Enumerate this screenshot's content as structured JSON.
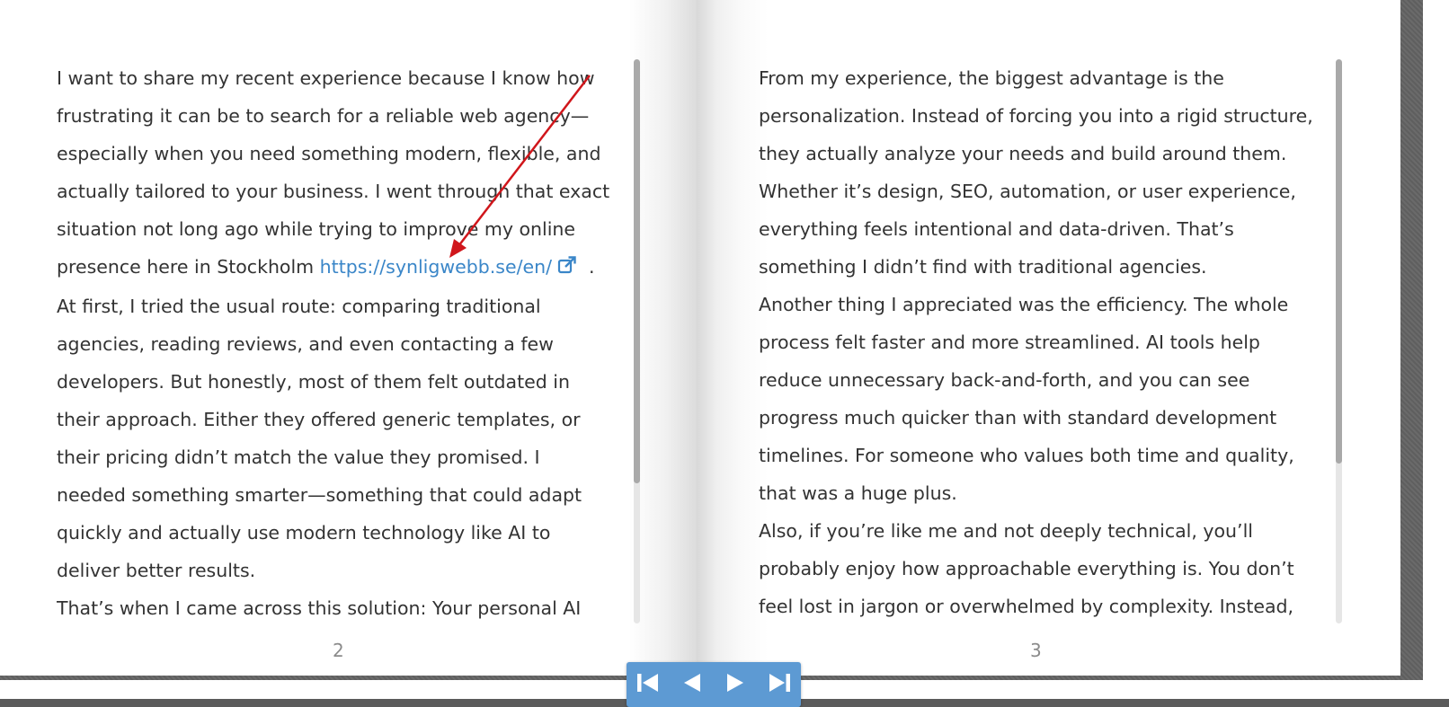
{
  "left_page": {
    "paragraphs": [
      {
        "text": "I want to share my recent experience because I know how frustrating it can be to search for a reliable web agency—especially when you need something modern, flexible, and actually tailored to your business. I went through that exact situation not long ago while trying to improve my online presence here in Stockholm",
        "link": "https://synligwebb.se/en/",
        "after": "."
      },
      {
        "text": "At first, I tried the usual route: comparing traditional agencies, reading reviews, and even contacting a few developers. But honestly, most of them felt outdated in their approach. Either they offered generic templates, or their pricing didn’t match the value they promised. I needed something smarter—something that could adapt quickly and actually use modern technology like AI to deliver better results."
      },
      {
        "text": "That’s when I came across this solution: Your personal AI web agency in Stockholm"
      }
    ],
    "page_number": "2"
  },
  "right_page": {
    "paragraphs": [
      {
        "text": "From my experience, the biggest advantage is the personalization. Instead of forcing you into a rigid structure, they actually analyze your needs and build around them. Whether it’s design, SEO, automation, or user experience, everything feels intentional and data-driven. That’s something I didn’t find with traditional agencies."
      },
      {
        "text": "Another thing I appreciated was the efficiency. The whole process felt faster and more streamlined. AI tools help reduce unnecessary back-and-forth, and you can see progress much quicker than with standard development timelines. For someone who values both time and quality, that was a huge plus."
      },
      {
        "text": "Also, if you’re like me and not deeply technical, you’ll probably enjoy how approachable everything is. You don’t feel lost in jargon or overwhelmed by complexity. Instead, the focus stays"
      }
    ],
    "page_number": "3"
  },
  "controls": {
    "first": "first-page-icon",
    "prev": "previous-page-icon",
    "next": "next-page-icon",
    "last": "last-page-icon"
  },
  "colors": {
    "link": "#3a86c8",
    "controls_bg": "#5d9ad3",
    "annotation_arrow": "#d0161b"
  }
}
